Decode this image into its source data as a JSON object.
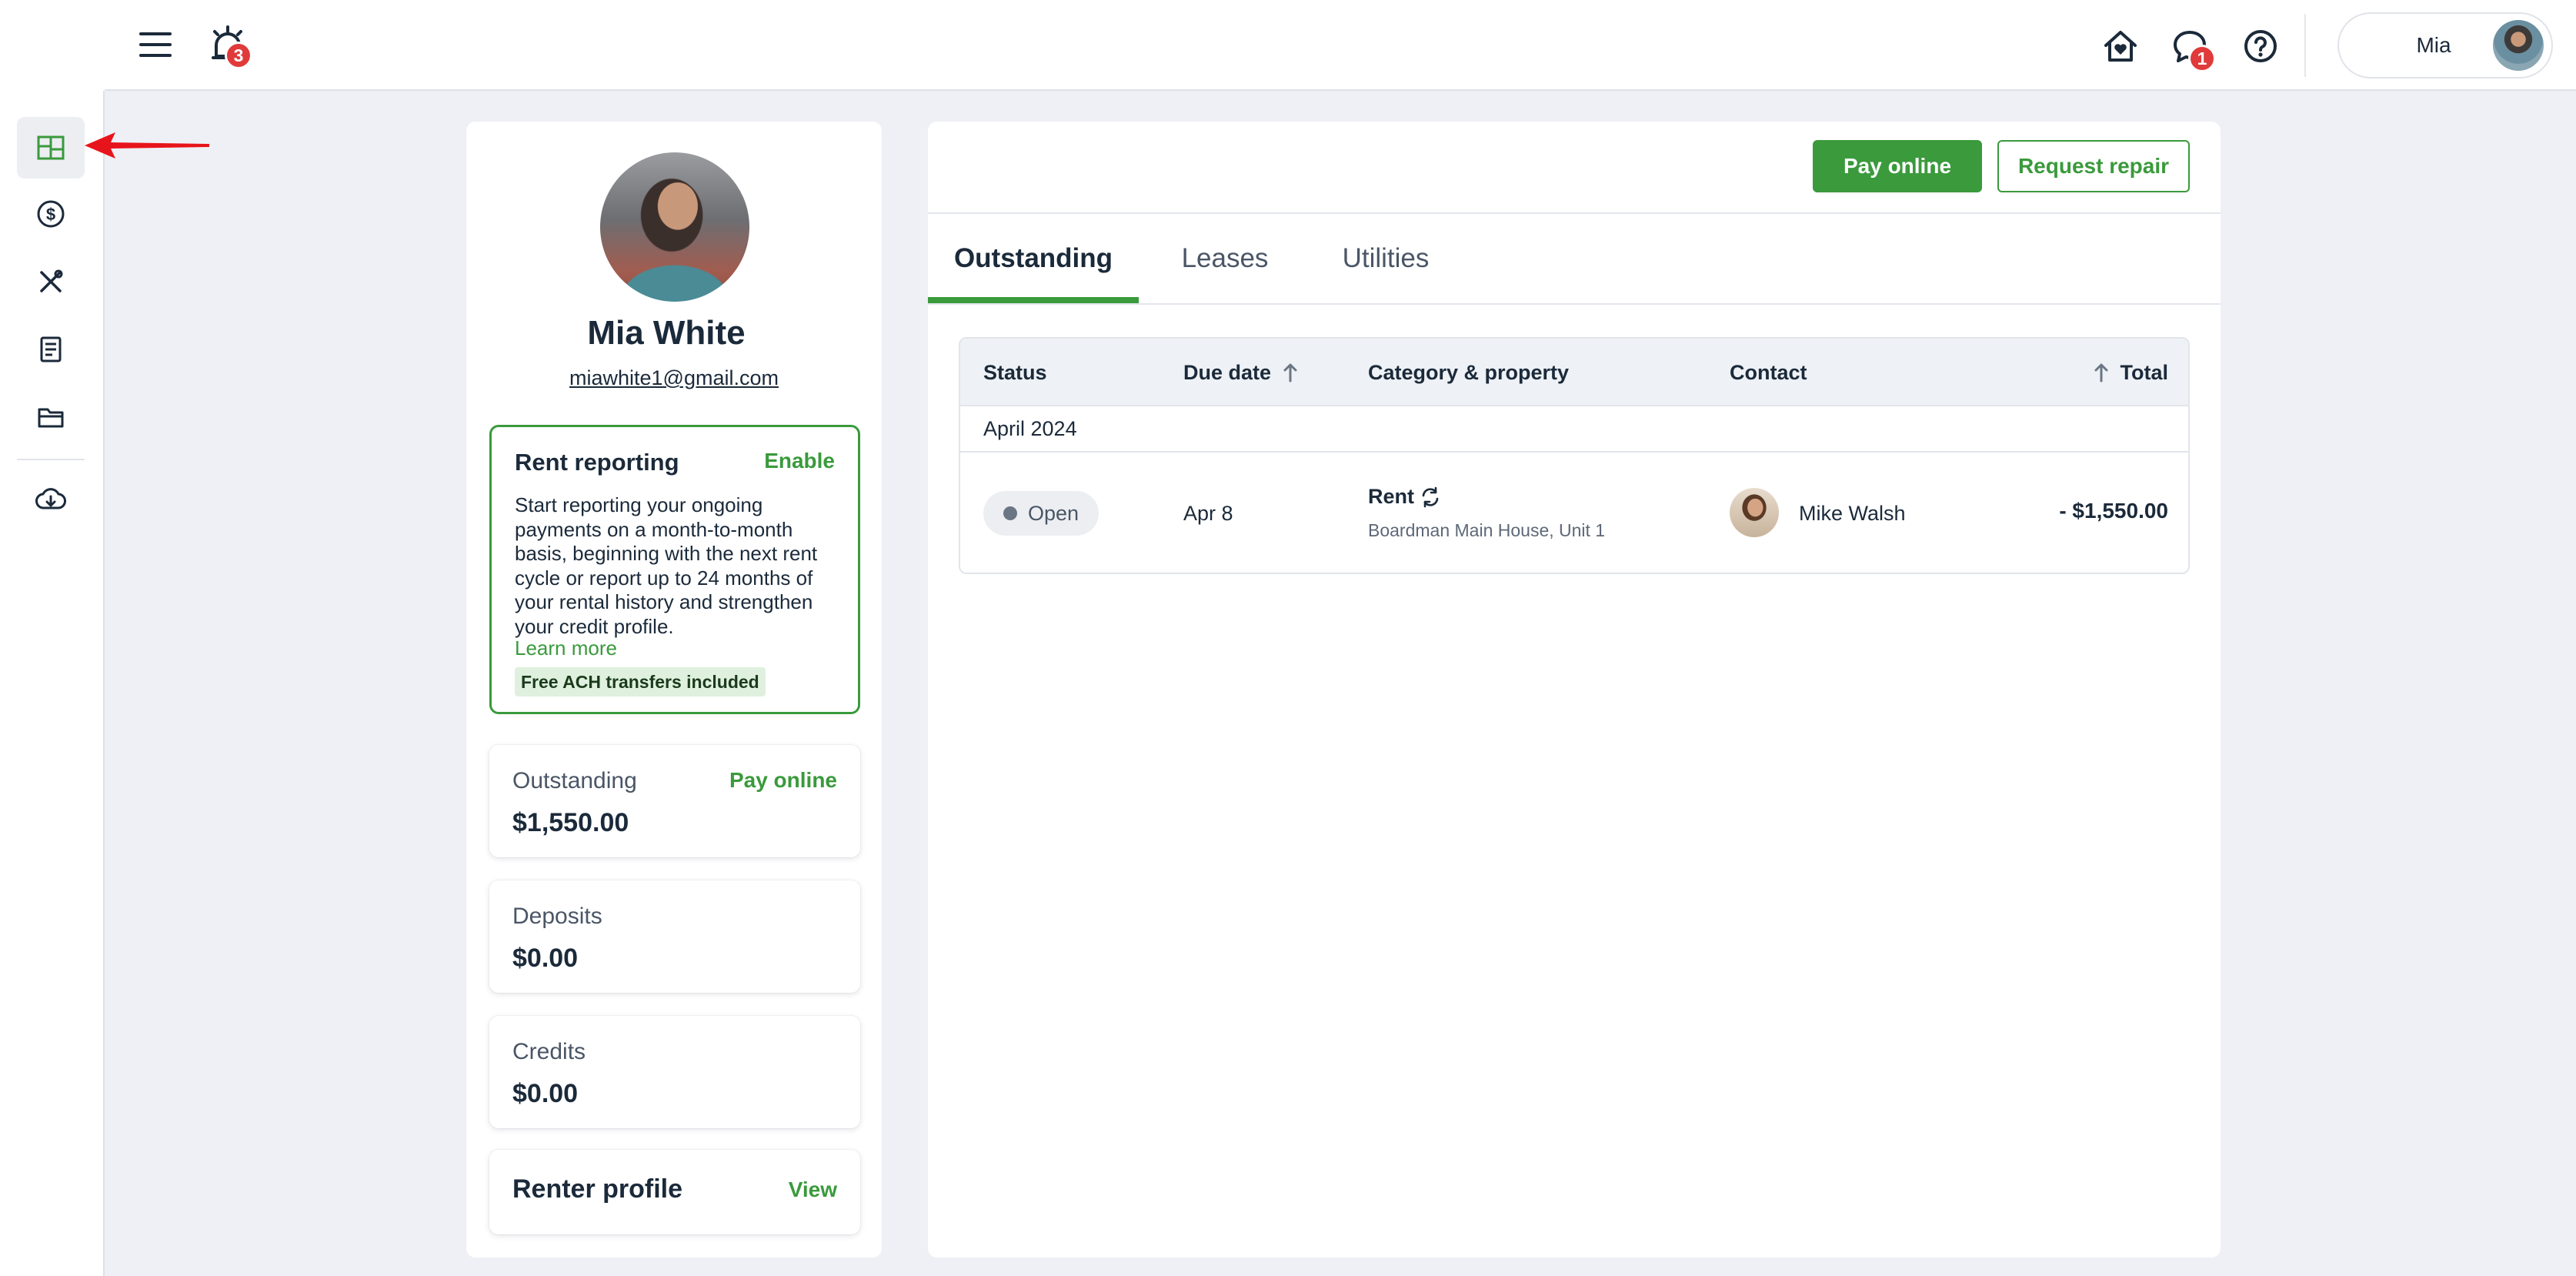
{
  "header": {
    "alerts_badge": "3",
    "messages_badge": "1",
    "user_name": "Mia"
  },
  "sidebar": {
    "items": [
      {
        "icon": "dashboard-icon",
        "active": true
      },
      {
        "icon": "dollar-icon"
      },
      {
        "icon": "tools-icon"
      },
      {
        "icon": "document-icon"
      },
      {
        "icon": "folder-icon"
      },
      {
        "icon": "download-icon"
      }
    ]
  },
  "profile": {
    "name": "Mia White",
    "email": "miawhite1@gmail.com",
    "rent_reporting": {
      "title": "Rent reporting",
      "enable_label": "Enable",
      "description": "Start reporting your ongoing payments on a month-to-month basis, beginning with the next rent cycle or report up to 24 months of your rental history and strengthen your credit profile.",
      "learn_more": "Learn more",
      "tag": "Free ACH transfers included"
    },
    "outstanding": {
      "label": "Outstanding",
      "value": "$1,550.00",
      "link": "Pay online"
    },
    "deposits": {
      "label": "Deposits",
      "value": "$0.00"
    },
    "credits": {
      "label": "Credits",
      "value": "$0.00"
    },
    "renter_profile": {
      "label": "Renter profile",
      "link": "View"
    }
  },
  "main": {
    "pay_online": "Pay online",
    "request_repair": "Request repair",
    "tabs": [
      {
        "label": "Outstanding",
        "active": true
      },
      {
        "label": "Leases"
      },
      {
        "label": "Utilities"
      }
    ],
    "table": {
      "columns": {
        "status": "Status",
        "due_date": "Due date",
        "category": "Category & property",
        "contact": "Contact",
        "total": "Total"
      },
      "group": "April 2024",
      "rows": [
        {
          "status": "Open",
          "due_date": "Apr 8",
          "category": "Rent",
          "property": "Boardman Main House, Unit 1",
          "contact": "Mike Walsh",
          "total": "- $1,550.00"
        }
      ]
    }
  },
  "colors": {
    "brand_green": "#3a9a3c",
    "badge_red": "#e03a3a",
    "arrow_red": "#e8141b",
    "background": "#eef0f5"
  }
}
